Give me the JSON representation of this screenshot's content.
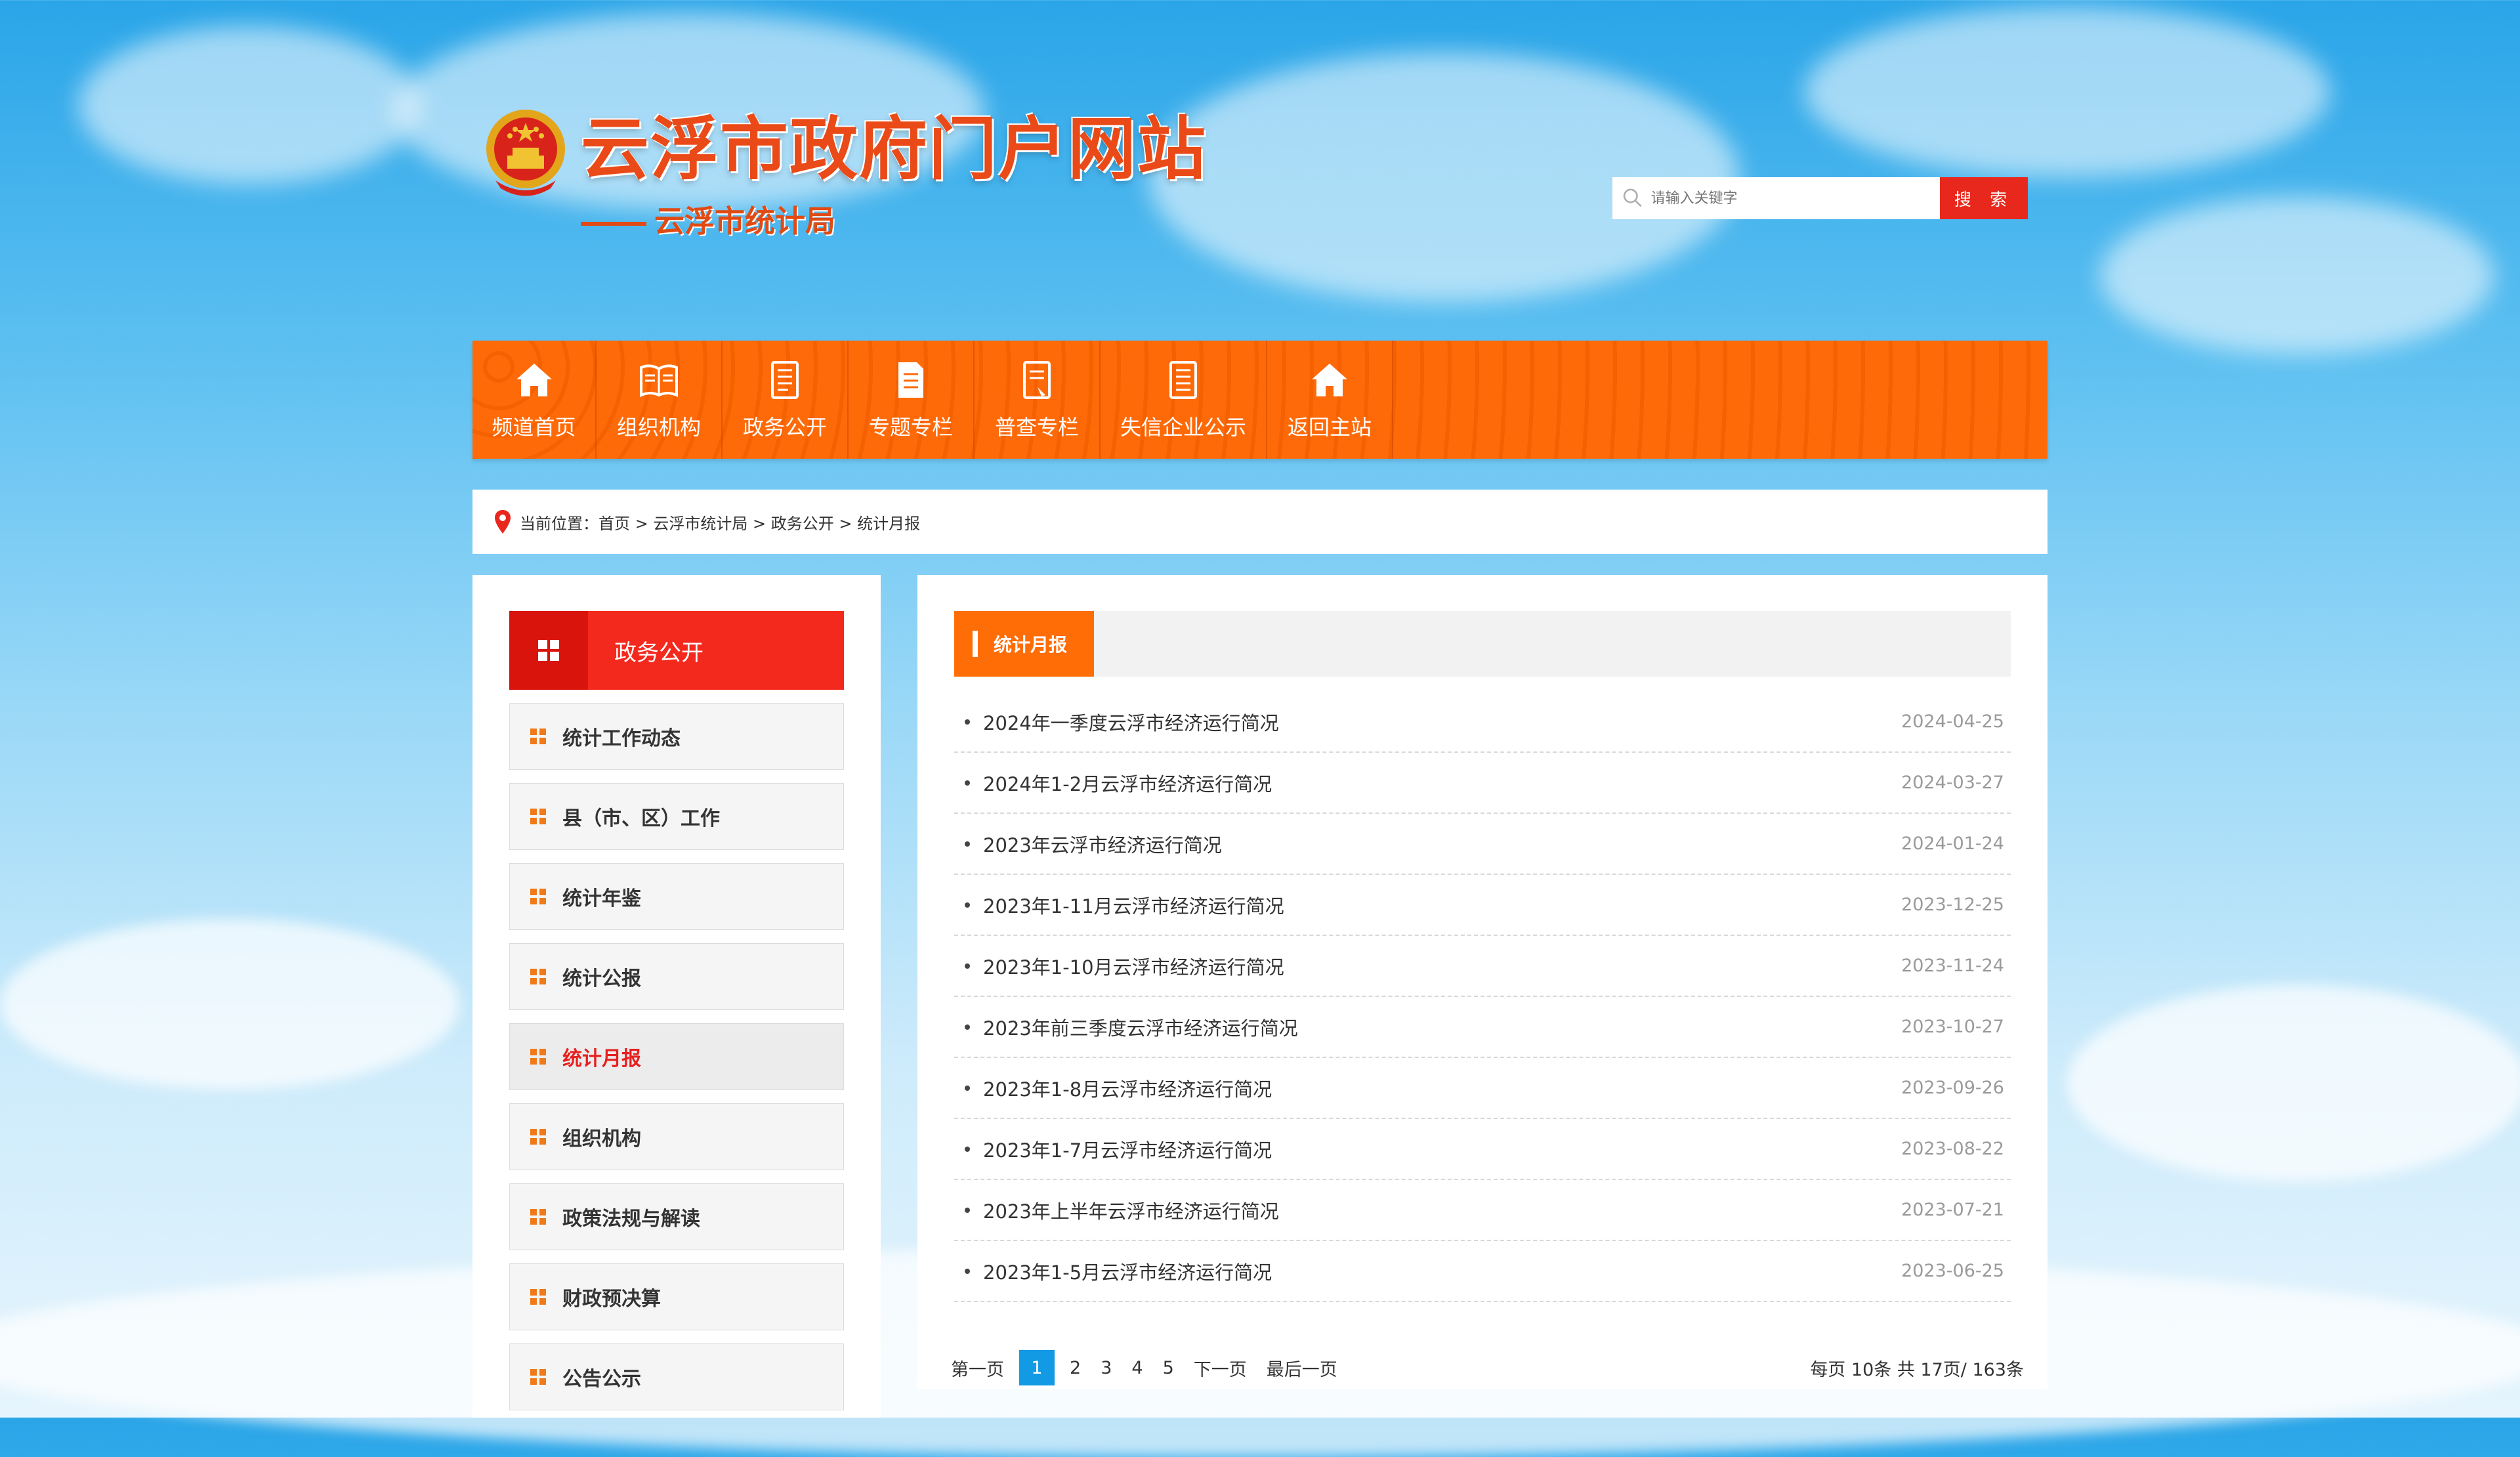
{
  "colors": {
    "accent_orange": "#ff6d07",
    "accent_red": "#e8281d",
    "page_blue": "#2aa5e8"
  },
  "header": {
    "site_title": "云浮市政府门户网站",
    "department": "云浮市统计局",
    "emblem_icon": "national-emblem-icon"
  },
  "search": {
    "placeholder": "请输入关键字",
    "button_label": "搜 索",
    "icon": "search-icon"
  },
  "nav": {
    "items": [
      {
        "label": "频道首页",
        "icon": "home-icon"
      },
      {
        "label": "组织机构",
        "icon": "book-icon"
      },
      {
        "label": "政务公开",
        "icon": "document-icon"
      },
      {
        "label": "专题专栏",
        "icon": "document-icon"
      },
      {
        "label": "普查专栏",
        "icon": "document-icon"
      },
      {
        "label": "失信企业公示",
        "icon": "document-icon"
      },
      {
        "label": "返回主站",
        "icon": "home-icon"
      }
    ]
  },
  "breadcrumb": {
    "text": "当前位置：首页 > 云浮市统计局 > 政务公开 > 统计月报",
    "icon": "location-pin-icon"
  },
  "sidebar": {
    "heading": "政务公开",
    "items": [
      {
        "label": "统计工作动态"
      },
      {
        "label": "县（市、区）工作"
      },
      {
        "label": "统计年鉴"
      },
      {
        "label": "统计公报"
      },
      {
        "label": "统计月报"
      },
      {
        "label": "组织机构"
      },
      {
        "label": "政策法规与解读"
      },
      {
        "label": "财政预决算"
      },
      {
        "label": "公告公示"
      }
    ],
    "active_index": 4
  },
  "main": {
    "tab_label": "统计月报",
    "articles": [
      {
        "title": "2024年一季度云浮市经济运行简况",
        "date": "2024-04-25"
      },
      {
        "title": "2024年1-2月云浮市经济运行简况",
        "date": "2024-03-27"
      },
      {
        "title": "2023年云浮市经济运行简况",
        "date": "2024-01-24"
      },
      {
        "title": "2023年1-11月云浮市经济运行简况",
        "date": "2023-12-25"
      },
      {
        "title": "2023年1-10月云浮市经济运行简况",
        "date": "2023-11-24"
      },
      {
        "title": "2023年前三季度云浮市经济运行简况",
        "date": "2023-10-27"
      },
      {
        "title": "2023年1-8月云浮市经济运行简况",
        "date": "2023-09-26"
      },
      {
        "title": "2023年1-7月云浮市经济运行简况",
        "date": "2023-08-22"
      },
      {
        "title": "2023年上半年云浮市经济运行简况",
        "date": "2023-07-21"
      },
      {
        "title": "2023年1-5月云浮市经济运行简况",
        "date": "2023-06-25"
      }
    ]
  },
  "pager": {
    "first": "第一页",
    "pages": [
      "1",
      "2",
      "3",
      "4",
      "5"
    ],
    "current": "1",
    "next": "下一页",
    "last": "最后一页",
    "summary": "每页 10条 共 17页/ 163条"
  }
}
